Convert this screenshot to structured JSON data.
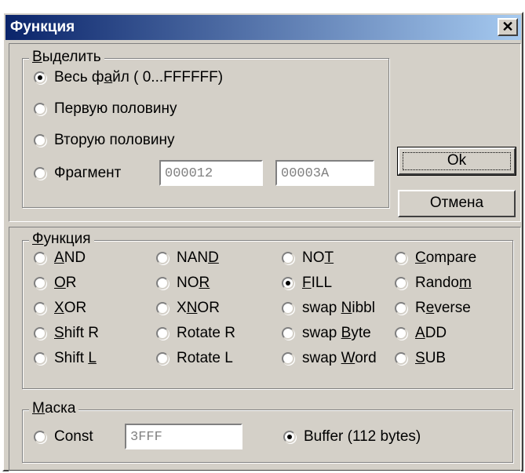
{
  "title": "Функция",
  "close_icon": "close-icon",
  "select_group": {
    "legend": {
      "hot": "В",
      "rest": "ыделить"
    },
    "options": [
      {
        "pre": "Весь ф",
        "hot": "а",
        "post": "йл  ( 0...FFFFFF)",
        "selected": true
      },
      {
        "pre": "Первую половину",
        "hot": "",
        "post": "",
        "selected": false
      },
      {
        "pre": "Вторую половину",
        "hot": "",
        "post": "",
        "selected": false
      },
      {
        "pre": "Фрагмент",
        "hot": "",
        "post": "",
        "selected": false
      }
    ],
    "fragment_start": "000012",
    "fragment_end": "00003A"
  },
  "buttons": {
    "ok": "Ok",
    "cancel": "Отмена"
  },
  "function_group": {
    "legend": {
      "hot": "Ф",
      "rest": "ункция"
    },
    "columns": [
      [
        {
          "pre": "",
          "hot": "A",
          "post": "ND",
          "selected": false
        },
        {
          "pre": "",
          "hot": "O",
          "post": "R",
          "selected": false
        },
        {
          "pre": "",
          "hot": "X",
          "post": "OR",
          "selected": false
        },
        {
          "pre": "",
          "hot": "S",
          "post": "hift R",
          "selected": false
        },
        {
          "pre": "Shift ",
          "hot": "L",
          "post": "",
          "selected": false
        }
      ],
      [
        {
          "pre": "NAN",
          "hot": "D",
          "post": "",
          "selected": false
        },
        {
          "pre": "NO",
          "hot": "R",
          "post": "",
          "selected": false
        },
        {
          "pre": "X",
          "hot": "N",
          "post": "OR",
          "selected": false
        },
        {
          "pre": "Rotate R",
          "hot": "",
          "post": "",
          "selected": false
        },
        {
          "pre": "Rotate L",
          "hot": "",
          "post": "",
          "selected": false
        }
      ],
      [
        {
          "pre": "NO",
          "hot": "T",
          "post": "",
          "selected": false
        },
        {
          "pre": "",
          "hot": "F",
          "post": "ILL",
          "selected": true
        },
        {
          "pre": "swap ",
          "hot": "N",
          "post": "ibbl",
          "selected": false
        },
        {
          "pre": "swap ",
          "hot": "B",
          "post": "yte",
          "selected": false
        },
        {
          "pre": "swap ",
          "hot": "W",
          "post": "ord",
          "selected": false
        }
      ],
      [
        {
          "pre": "",
          "hot": "C",
          "post": "ompare",
          "selected": false
        },
        {
          "pre": "Rando",
          "hot": "m",
          "post": "",
          "selected": false
        },
        {
          "pre": "R",
          "hot": "e",
          "post": "verse",
          "selected": false
        },
        {
          "pre": "",
          "hot": "A",
          "post": "DD",
          "selected": false
        },
        {
          "pre": "",
          "hot": "S",
          "post": "UB",
          "selected": false
        }
      ]
    ]
  },
  "mask_group": {
    "legend": {
      "hot": "М",
      "rest": "аска"
    },
    "const_label": "Const",
    "const_selected": false,
    "const_value": "3FFF",
    "buffer_label": "Buffer (112 bytes)",
    "buffer_selected": true
  }
}
